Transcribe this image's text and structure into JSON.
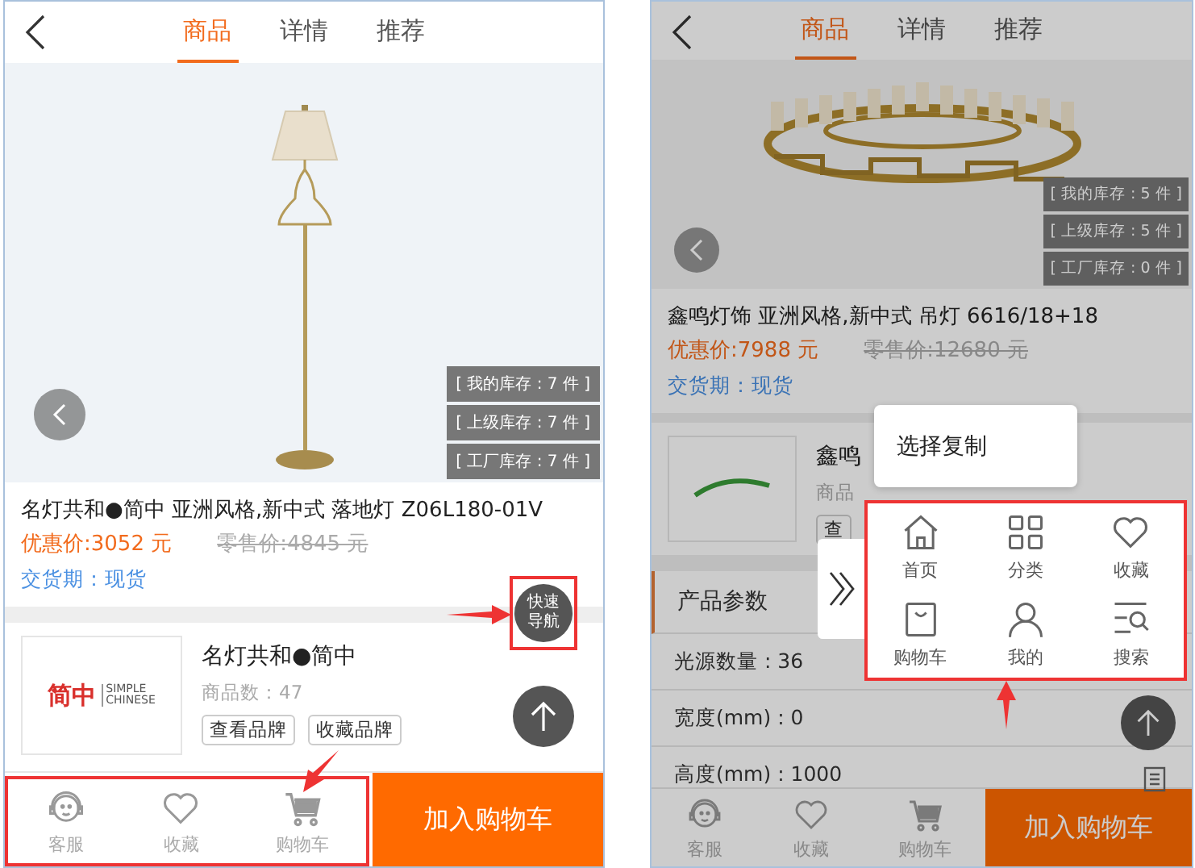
{
  "left_screen": {
    "tabs": [
      {
        "label": "商品",
        "selected": true
      },
      {
        "label": "详情",
        "selected": false
      },
      {
        "label": "推荐",
        "selected": false
      }
    ],
    "stock_tags": [
      "[ 我的库存 : 7 件 ]",
      "[ 上级库存 : 7 件 ]",
      "[ 工厂库存 : 7 件 ]"
    ],
    "product": {
      "title": "名灯共和●简中 亚洲风格,新中式 落地灯 Z06L180-01V",
      "sale_price": "优惠价:3052 元",
      "retail_price": "零售价:4845 元",
      "delivery_label": "交货期：",
      "delivery_value": "现货"
    },
    "brand": {
      "logo_mark": "简中",
      "logo_text": [
        "SIMPLE",
        "CHINESE"
      ],
      "name": "名灯共和●简中",
      "product_count": "商品数：47",
      "buttons": [
        "查看品牌",
        "收藏品牌"
      ]
    },
    "quick_nav_button": [
      "快速",
      "导航"
    ],
    "bottom_bar": {
      "items": [
        {
          "kind": "service",
          "label": "客服"
        },
        {
          "kind": "favorite",
          "label": "收藏"
        },
        {
          "kind": "cart",
          "label": "购物车"
        }
      ],
      "cart_button": "加入购物车"
    }
  },
  "right_screen": {
    "tabs": [
      {
        "label": "商品",
        "selected": true
      },
      {
        "label": "详情",
        "selected": false
      },
      {
        "label": "推荐",
        "selected": false
      }
    ],
    "stock_tags": [
      "[ 我的库存 : 5 件 ]",
      "[ 上级库存 : 5 件 ]",
      "[ 工厂库存 : 0 件 ]"
    ],
    "product": {
      "title": "鑫鸣灯饰 亚洲风格,新中式 吊灯 6616/18+18",
      "sale_price": "优惠价:7988 元",
      "retail_price": "零售价:12680 元",
      "delivery_label": "交货期：",
      "delivery_value": "现货"
    },
    "brand": {
      "name": "鑫鸣",
      "product_count": "商品",
      "buttons": [
        "查"
      ]
    },
    "params": {
      "title": "产品参数",
      "rows": [
        "光源数量 : 36",
        "宽度(mm) : 0",
        "高度(mm) : 1000"
      ]
    },
    "context_menu": [
      "选择复制"
    ],
    "quick_nav": [
      {
        "kind": "home",
        "label": "首页"
      },
      {
        "kind": "category",
        "label": "分类"
      },
      {
        "kind": "favorite",
        "label": "收藏"
      },
      {
        "kind": "bag",
        "label": "购物车"
      },
      {
        "kind": "profile",
        "label": "我的"
      },
      {
        "kind": "search",
        "label": "搜索"
      }
    ],
    "bottom_bar": {
      "items": [
        {
          "kind": "service",
          "label": "客服"
        },
        {
          "kind": "favorite",
          "label": "收藏"
        },
        {
          "kind": "cart",
          "label": "购物车"
        }
      ],
      "cart_button": "加入购物车"
    }
  }
}
